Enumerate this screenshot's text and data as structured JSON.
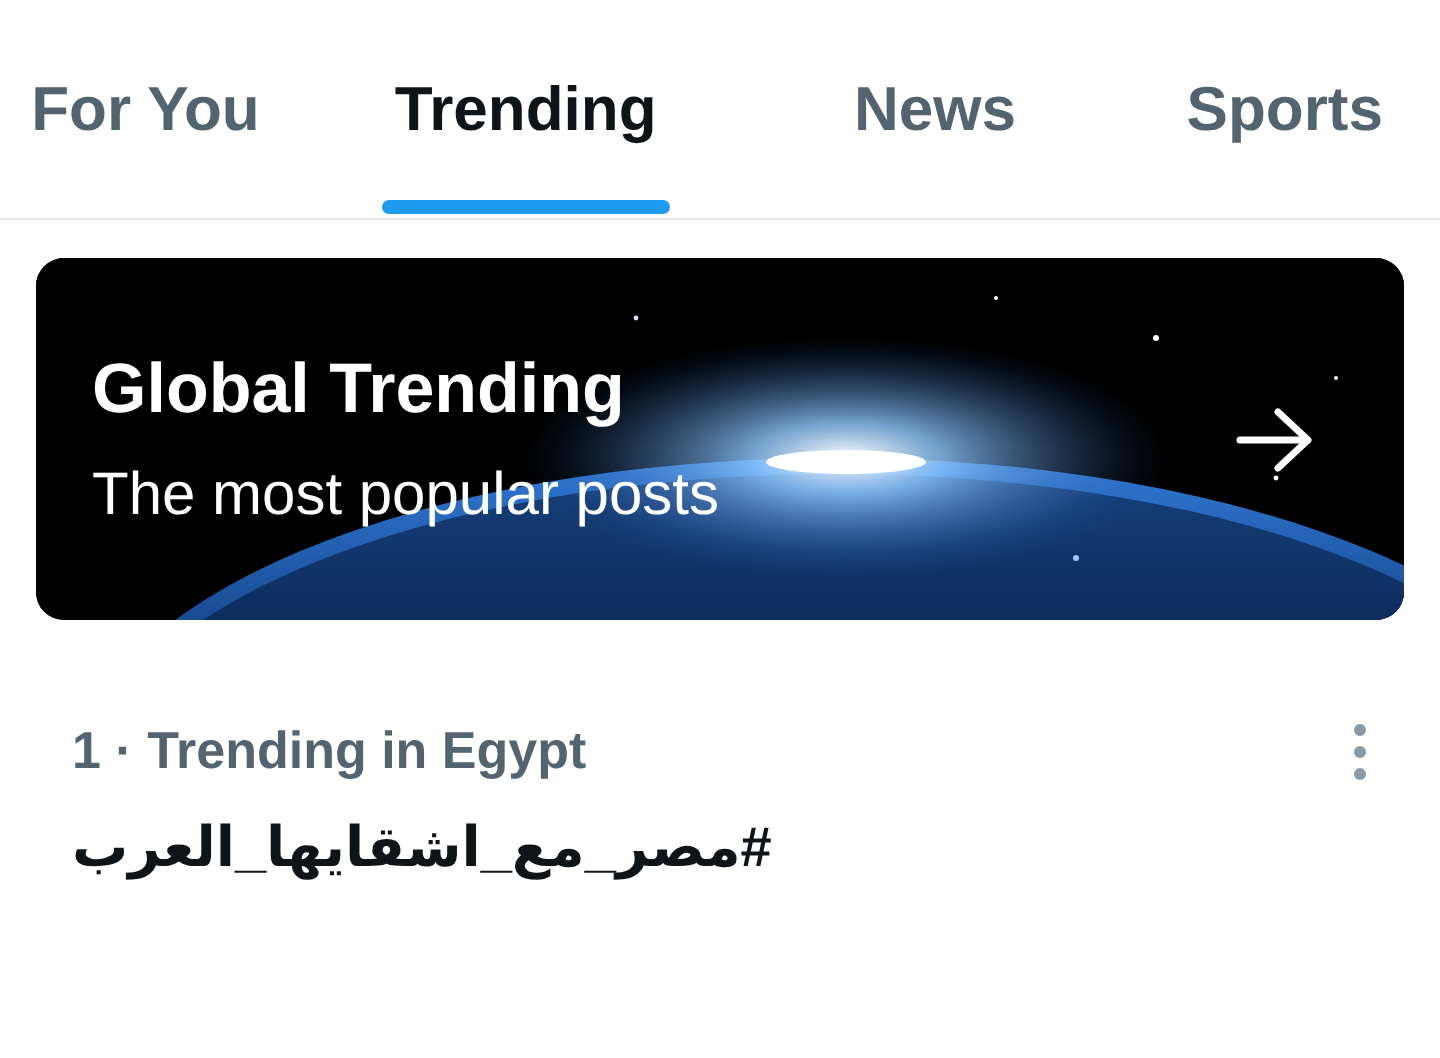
{
  "tabs": [
    {
      "label": "For You",
      "selected": false
    },
    {
      "label": "Trending",
      "selected": true
    },
    {
      "label": "News",
      "selected": false
    },
    {
      "label": "Sports",
      "selected": false
    }
  ],
  "banner": {
    "title": "Global Trending",
    "subtitle": "The most popular posts",
    "kind": "picture"
  },
  "trends": [
    {
      "context": "1 · Trending in Egypt",
      "topic": "#مصر_مع_اشقايها_العرب"
    }
  ]
}
